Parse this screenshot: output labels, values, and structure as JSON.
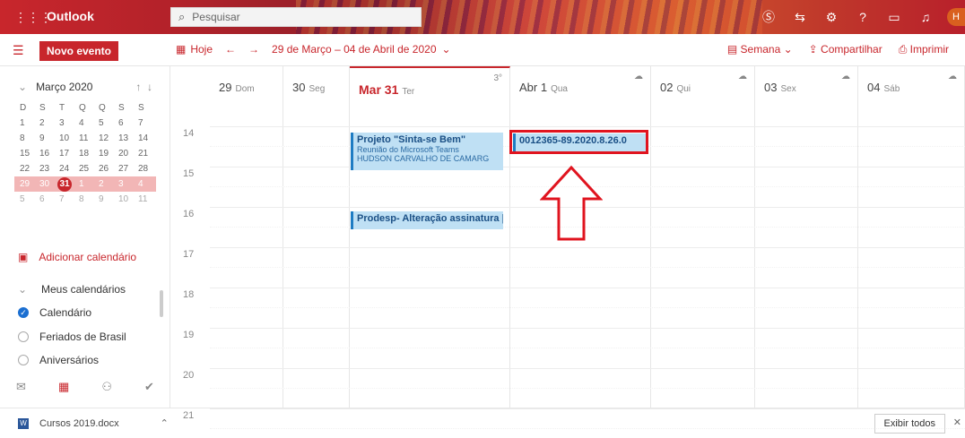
{
  "header": {
    "brand": "Outlook",
    "search_placeholder": "Pesquisar",
    "waffle_icon": "waffle-icon",
    "avatar_initial": "H",
    "accent": "#c8262c"
  },
  "toolbar": {
    "new_event": "Novo evento",
    "today": "Hoje",
    "range": "29 de Março – 04 de Abril de 2020",
    "view": "Semana",
    "share": "Compartilhar",
    "print": "Imprimir"
  },
  "mini_calendar": {
    "month": "Março 2020",
    "weekdays": [
      "D",
      "S",
      "T",
      "Q",
      "Q",
      "S",
      "S"
    ],
    "weeks": [
      [
        "1",
        "2",
        "3",
        "4",
        "5",
        "6",
        "7"
      ],
      [
        "8",
        "9",
        "10",
        "11",
        "12",
        "13",
        "14"
      ],
      [
        "15",
        "16",
        "17",
        "18",
        "19",
        "20",
        "21"
      ],
      [
        "22",
        "23",
        "24",
        "25",
        "26",
        "27",
        "28"
      ],
      [
        "29",
        "30",
        "31",
        "1",
        "2",
        "3",
        "4"
      ],
      [
        "5",
        "6",
        "7",
        "8",
        "9",
        "10",
        "11"
      ]
    ],
    "today": "31"
  },
  "sidebar": {
    "add_calendar": "Adicionar calendário",
    "my_calendars": "Meus calendários",
    "calendars": [
      {
        "label": "Calendário",
        "checked": true
      },
      {
        "label": "Feriados de Brasil",
        "checked": false
      },
      {
        "label": "Aniversários",
        "checked": false
      }
    ]
  },
  "days": [
    {
      "num": "29",
      "name": "Dom",
      "weather": ""
    },
    {
      "num": "30",
      "name": "Seg",
      "weather": ""
    },
    {
      "num": "Mar 31",
      "name": "Ter",
      "weather": "3°",
      "current": true
    },
    {
      "num": "Abr 1",
      "name": "Qua",
      "weather": "☁"
    },
    {
      "num": "02",
      "name": "Qui",
      "weather": "☁"
    },
    {
      "num": "03",
      "name": "Sex",
      "weather": "☁"
    },
    {
      "num": "04",
      "name": "Sáb",
      "weather": "☁"
    }
  ],
  "hours": [
    "14",
    "15",
    "16",
    "17",
    "18",
    "19",
    "20",
    "21"
  ],
  "events": {
    "e1": {
      "title": "Projeto \"Sinta-se Bem\"",
      "line2": "Reunião do Microsoft Teams",
      "line3": "HUDSON CARVALHO DE CAMARG"
    },
    "e2": {
      "title": "Prodesp- Alteração assinatura |"
    },
    "e3": {
      "title": "0012365-89.2020.8.26.0"
    }
  },
  "bottom": {
    "file": "Cursos 2019.docx",
    "show_all": "Exibir todos"
  }
}
